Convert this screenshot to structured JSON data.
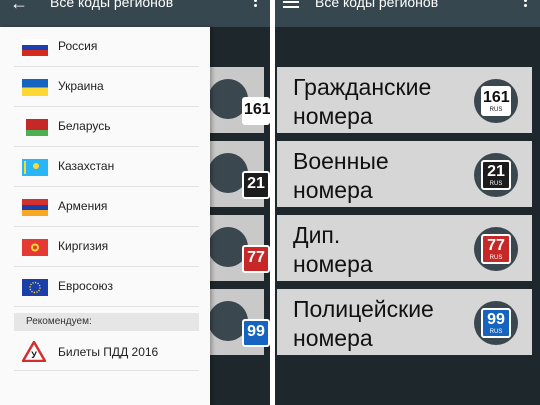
{
  "left_screen": {
    "title": "Все коды регионов",
    "drawer": {
      "items": [
        {
          "label": "Россия",
          "flag": "russia-flag"
        },
        {
          "label": "Украина",
          "flag": "ukraine-flag"
        },
        {
          "label": "Беларусь",
          "flag": "belarus-flag"
        },
        {
          "label": "Казахстан",
          "flag": "kazakhstan-flag"
        },
        {
          "label": "Армения",
          "flag": "armenia-flag"
        },
        {
          "label": "Киргизия",
          "flag": "kyrgyzstan-flag"
        },
        {
          "label": "Евросоюз",
          "flag": "eu-flag"
        }
      ],
      "section_header": "Рекомендуем:",
      "promo": {
        "label": "Билеты ПДД 2016",
        "icon": "road-sign-icon"
      }
    },
    "peek_codes": [
      "161",
      "21",
      "77",
      "99"
    ]
  },
  "right_screen": {
    "title": "Все коды регионов",
    "cards": [
      {
        "label": "Гражданские\nномера",
        "code": "161",
        "sub": "RUS",
        "plate_bg": "#ffffff",
        "plate_fg": "#111111"
      },
      {
        "label": "Военные\nномера",
        "code": "21",
        "sub": "RUS",
        "plate_bg": "#1c1c1c",
        "plate_fg": "#ffffff"
      },
      {
        "label": "Дип.\nномера",
        "code": "77",
        "sub": "RUS",
        "plate_bg": "#c62828",
        "plate_fg": "#ffffff"
      },
      {
        "label": "Полицейские\nномера",
        "code": "99",
        "sub": "RUS",
        "plate_bg": "#1565c0",
        "plate_fg": "#ffffff"
      }
    ]
  },
  "colors": {
    "toolbar": "#37474f",
    "background": "#1e272b",
    "card": "#d6d6d6"
  }
}
